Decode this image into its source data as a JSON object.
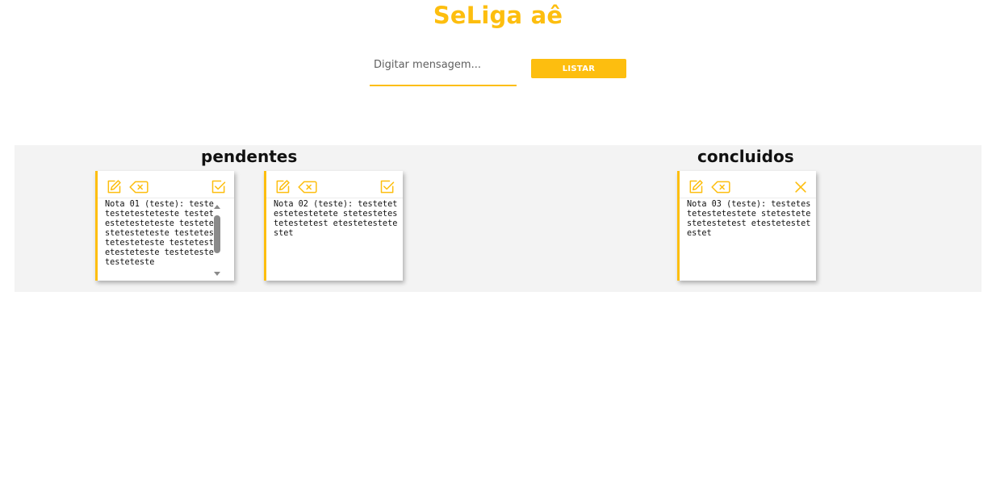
{
  "app": {
    "title": "SeLiga aê",
    "accent_color": "#fdbe0f"
  },
  "search": {
    "placeholder": "Digitar mensagem...",
    "value": ""
  },
  "toolbar": {
    "list_label": "LISTAR"
  },
  "columns": {
    "pending": {
      "title": "pendentes",
      "notes": [
        {
          "text": "Nota 01 (teste): testetestetesteteste testetestetesteteste testetestetesteteste testetestetesteteste testetestetesteteste testetestetesteteste",
          "icons": [
            "edit-icon",
            "delete-icon",
            "check-icon"
          ],
          "has_scrollbar": true
        },
        {
          "text": "Nota 02 (teste): testetetestetestetete stetestetestetestetest etestetestetestet",
          "icons": [
            "edit-icon",
            "delete-icon",
            "check-icon"
          ],
          "has_scrollbar": false
        }
      ]
    },
    "done": {
      "title": "concluidos",
      "notes": [
        {
          "text": "Nota 03 (teste): testetestetestetestete stetestetestetestetest etestetestetestet",
          "icons": [
            "edit-icon",
            "delete-icon",
            "close-icon"
          ],
          "has_scrollbar": false
        }
      ]
    }
  }
}
